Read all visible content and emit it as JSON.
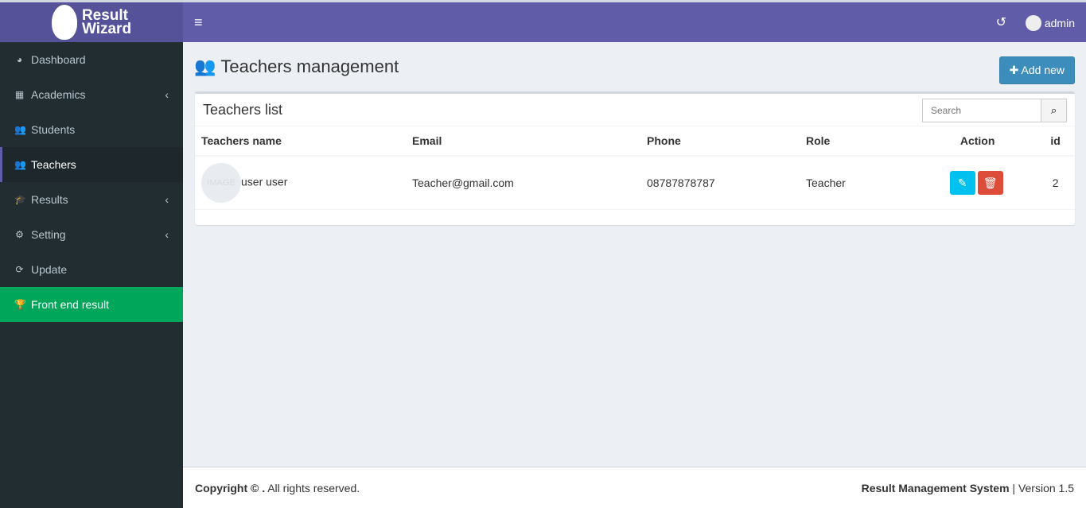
{
  "brand": {
    "line1": "Result",
    "line2": "Wizard"
  },
  "header": {
    "user": "admin"
  },
  "sidebar": {
    "items": [
      {
        "label": "Dashboard",
        "icon": "◕"
      },
      {
        "label": "Academics",
        "icon": "▦",
        "chev": "‹"
      },
      {
        "label": "Students",
        "icon": "👥"
      },
      {
        "label": "Teachers",
        "icon": "👥"
      },
      {
        "label": "Results",
        "icon": "🎓",
        "chev": "‹"
      },
      {
        "label": "Setting",
        "icon": "⚙",
        "chev": "‹"
      },
      {
        "label": "Update",
        "icon": "⟳"
      },
      {
        "label": "Front end result",
        "icon": "🏆"
      }
    ]
  },
  "page": {
    "title": "Teachers management",
    "add_label": "Add new"
  },
  "box": {
    "title": "Teachers list",
    "search_placeholder": "Search"
  },
  "table": {
    "headers": [
      "Teachers name",
      "Email",
      "Phone",
      "Role",
      "Action",
      "id"
    ],
    "rows": [
      {
        "image": "IMAGE",
        "name": "user user",
        "email": "Teacher@gmail.com",
        "phone": "08787878787",
        "role": "Teacher",
        "id": "2"
      }
    ]
  },
  "footer": {
    "copyright": "Copyright © .",
    "rights": " All rights reserved.",
    "system": "Result Management System",
    "version": " | Version 1.5"
  },
  "colors": {
    "navbar": "#605ca8",
    "green": "#00a65a",
    "edit": "#00c0ef",
    "delete": "#dd4b39",
    "primary": "#3c8dbc"
  }
}
